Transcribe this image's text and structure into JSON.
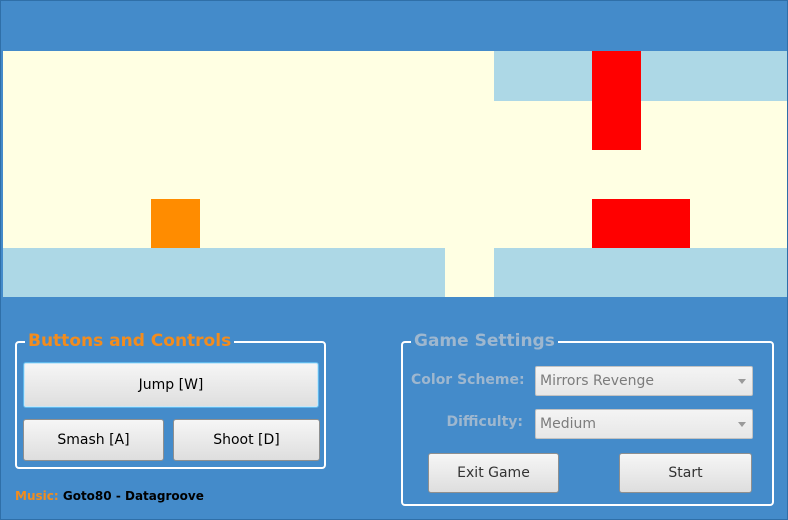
{
  "colors": {
    "window_bg": "#448bca",
    "sky": "#ffffe3",
    "platform": "#add8e6",
    "player": "#ff8c00",
    "obstacle": "#ff0000",
    "accent_title": "#f28c1e",
    "disabled_text": "#9eb7cf"
  },
  "controls": {
    "title": "Buttons and Controls",
    "jump_label": "Jump [W]",
    "smash_label": "Smash [A]",
    "shoot_label": "Shoot [D]"
  },
  "settings": {
    "title": "Game Settings",
    "color_scheme_label": "Color Scheme:",
    "color_scheme_value": "Mirrors Revenge",
    "difficulty_label": "Difficulty:",
    "difficulty_value": "Medium",
    "exit_label": "Exit Game",
    "start_label": "Start"
  },
  "music": {
    "label": "Music:",
    "artist": "Goto80",
    "separator": "-",
    "track": "Datagroove"
  }
}
